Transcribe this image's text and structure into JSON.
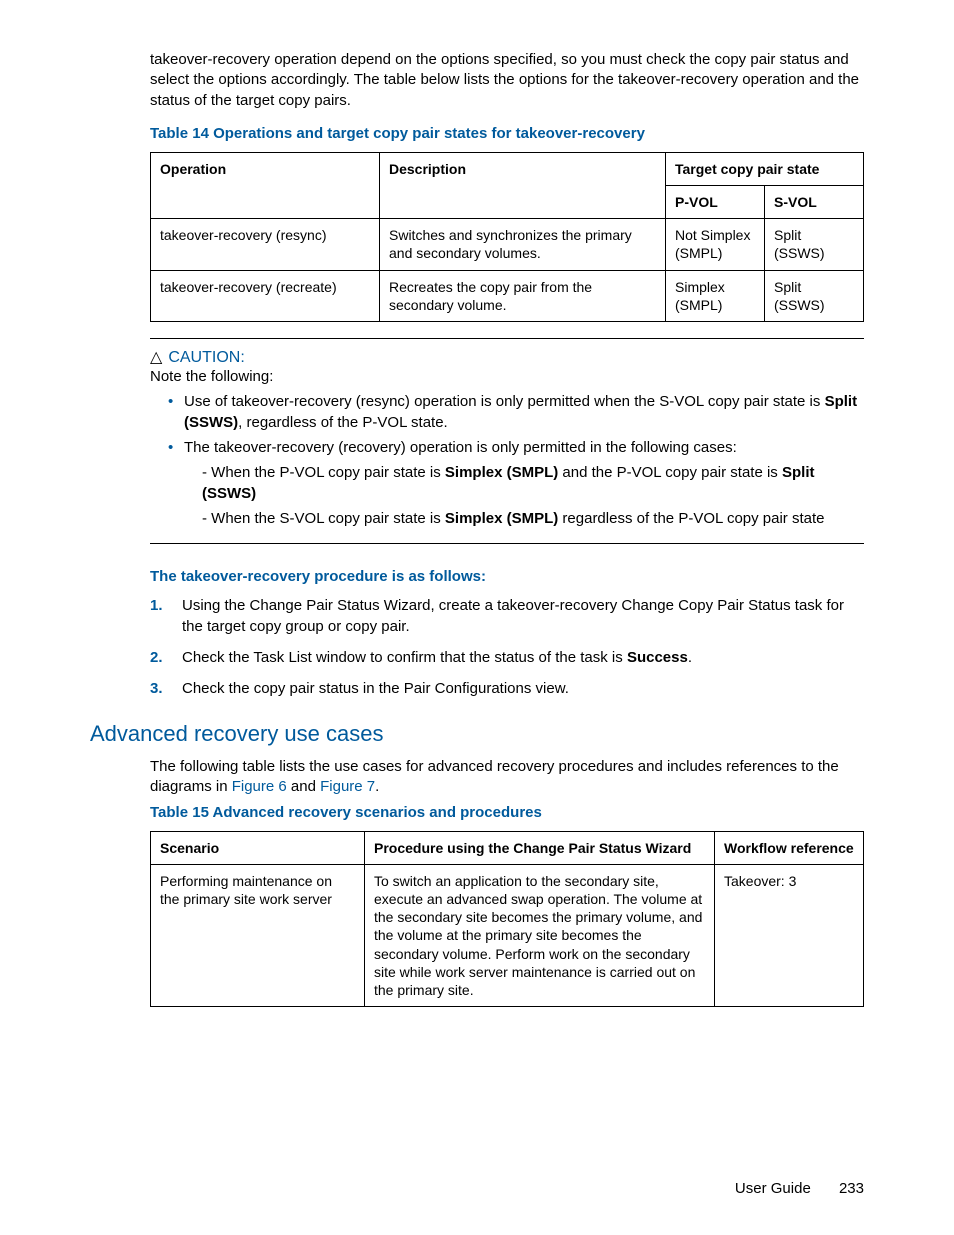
{
  "intro": "takeover-recovery operation depend on the options specified, so you must check the copy pair status and select the options accordingly. The table below lists the options for the takeover-recovery operation and the status of the target copy pairs.",
  "table14": {
    "title": "Table 14 Operations and target copy pair states for takeover-recovery",
    "headers": {
      "operation": "Operation",
      "description": "Description",
      "target": "Target copy pair state",
      "pvol": "P-VOL",
      "svol": "S-VOL"
    },
    "rows": [
      {
        "op": "takeover-recovery (resync)",
        "desc": "Switches and synchronizes the primary and secondary volumes.",
        "pvol": "Not Simplex (SMPL)",
        "svol": "Split (SSWS)"
      },
      {
        "op": "takeover-recovery (recreate)",
        "desc": "Recreates the copy pair from the secondary volume.",
        "pvol": "Simplex (SMPL)",
        "svol": "Split (SSWS)"
      }
    ]
  },
  "caution": {
    "label": "CAUTION:",
    "note": "Note the following:",
    "b1_a": "Use of takeover-recovery (resync) operation is only permitted when the S-VOL copy pair state is ",
    "b1_bold": "Split (SSWS)",
    "b1_b": ", regardless of the P-VOL state.",
    "b2": "The takeover-recovery (recovery) operation is only permitted in the following cases:",
    "b2s1_a": "- When the P-VOL copy pair state is ",
    "b2s1_bold1": "Simplex (SMPL)",
    "b2s1_b": " and the P-VOL copy pair state is ",
    "b2s1_bold2": "Split (SSWS)",
    "b2s2_a": "- When the S-VOL copy pair state is ",
    "b2s2_bold": "Simplex (SMPL)",
    "b2s2_b": " regardless of the P-VOL copy pair state"
  },
  "procedure": {
    "title": "The takeover-recovery procedure is as follows:",
    "step1": "Using the Change Pair Status Wizard, create a takeover-recovery Change Copy Pair Status task for the target copy group or copy pair.",
    "step2_a": "Check the Task List window to confirm that the status of the task is ",
    "step2_bold": "Success",
    "step2_b": ".",
    "step3": "Check the copy pair status in the Pair Configurations view."
  },
  "section2": {
    "heading": "Advanced recovery use cases",
    "intro_a": "The following table lists the use cases for advanced recovery procedures and includes references to the diagrams in ",
    "link1": "Figure 6",
    "intro_b": " and ",
    "link2": "Figure 7",
    "intro_c": "."
  },
  "table15": {
    "title": "Table 15 Advanced recovery scenarios and procedures",
    "headers": {
      "scenario": "Scenario",
      "procedure": "Procedure using the Change Pair Status Wizard",
      "workflow": "Workflow reference"
    },
    "rows": [
      {
        "scenario": "Performing maintenance on the primary site work server",
        "procedure": "To switch an application to the secondary site, execute an advanced swap operation. The volume at the secondary site becomes the primary volume, and the volume at the primary site becomes the secondary volume. Perform work on the secondary site while work server maintenance is carried out on the primary site.",
        "workflow": "Takeover: 3"
      }
    ]
  },
  "footer": {
    "label": "User Guide",
    "page": "233"
  }
}
